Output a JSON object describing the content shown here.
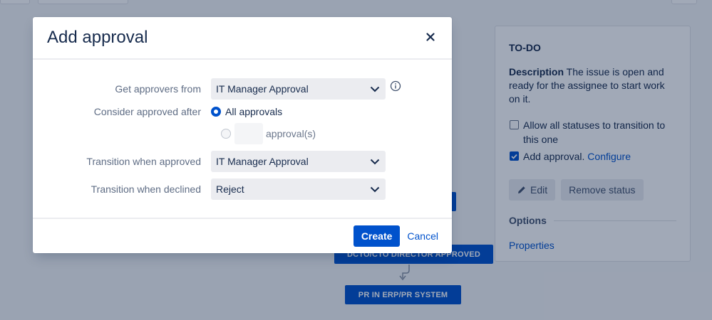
{
  "background": {
    "side_panel": {
      "status_title": "TO-DO",
      "description_label": "Description",
      "description_text": " The issue is open and ready for the assignee to start work on it.",
      "allow_all_label": "Allow all statuses to transition to this one",
      "allow_all_checked": false,
      "add_approval_label": "Add approval.",
      "add_approval_checked": true,
      "configure_link": "Configure",
      "edit_button": "Edit",
      "remove_status_button": "Remove status",
      "options_heading": "Options",
      "properties_link": "Properties"
    },
    "workflow": {
      "node_director": "DCTO/CTO DIRECTOR APPROVED",
      "node_pr": "PR IN ERP/PR SYSTEM"
    }
  },
  "modal": {
    "title": "Add approval",
    "close_icon": "close-icon",
    "fields": {
      "approvers_from": {
        "label": "Get approvers from",
        "value": "IT Manager Approval"
      },
      "consider_after": {
        "label": "Consider approved after",
        "option_all": "All approvals",
        "option_count_suffix": "approval(s)",
        "selected": "all"
      },
      "transition_approved": {
        "label": "Transition when approved",
        "value": "IT Manager Approval"
      },
      "transition_declined": {
        "label": "Transition when declined",
        "value": "Reject"
      }
    },
    "footer": {
      "create_button": "Create",
      "cancel_button": "Cancel"
    }
  },
  "colors": {
    "primary": "#0052cc",
    "overlay": "rgba(9,30,66,0.38)"
  }
}
